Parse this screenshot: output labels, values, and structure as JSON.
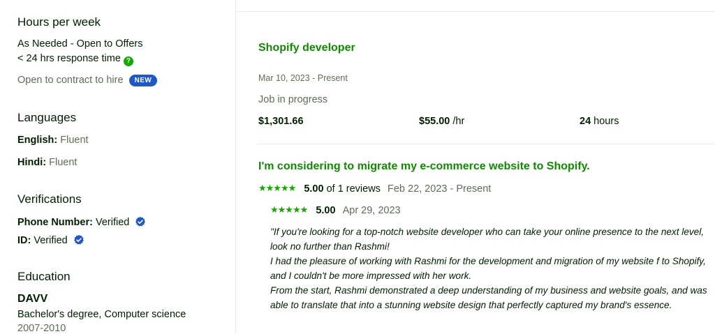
{
  "sidebar": {
    "hours": {
      "heading": "Hours per week",
      "availability": "As Needed - Open to Offers",
      "response_time": "< 24 hrs response time",
      "contract": "Open to contract to hire",
      "badge": "NEW"
    },
    "languages": {
      "heading": "Languages",
      "items": [
        {
          "name": "English:",
          "level": "Fluent"
        },
        {
          "name": "Hindi:",
          "level": "Fluent"
        }
      ]
    },
    "verifications": {
      "heading": "Verifications",
      "items": [
        {
          "name": "Phone Number:",
          "status": "Verified"
        },
        {
          "name": "ID:",
          "status": "Verified"
        }
      ]
    },
    "education": {
      "heading": "Education",
      "school": "DAVV",
      "degree": "Bachelor's degree, Computer science",
      "years": "2007-2010"
    }
  },
  "jobs": [
    {
      "title": "Shopify developer",
      "dates": "Mar 10, 2023 - Present",
      "status": "Job in progress",
      "earned": "$1,301.66",
      "rate": "$55.00",
      "rate_unit": "/hr",
      "hours": "24",
      "hours_unit": "hours"
    },
    {
      "title": "I'm considering to migrate my e-commerce website to Shopify.",
      "rating": "5.00",
      "reviews": "of 1 reviews",
      "dates": "Feb 22, 2023 - Present",
      "feedback": {
        "rating": "5.00",
        "date": "Apr 29, 2023",
        "lines": [
          "\"If you're looking for a top-notch website developer who can take your online presence to the next level, look no further than Rashmi!",
          "I had the pleasure of working with Rashmi for the development and migration of my website f to Shopify, and I couldn't be more impressed with her work.",
          "From the start, Rashmi demonstrated a deep understanding of my business and website goals, and was able to translate that into a stunning website design that perfectly captured my brand's essence."
        ]
      }
    }
  ],
  "colors": {
    "accent_green": "#108a00",
    "star_green": "#14a800",
    "badge_blue": "#1f57c3",
    "verified_blue": "#1f57c3",
    "muted_text": "#5e6d55"
  },
  "icons": {
    "help": "question-circle-icon",
    "verified": "verified-badge-icon",
    "star": "star-icon"
  }
}
